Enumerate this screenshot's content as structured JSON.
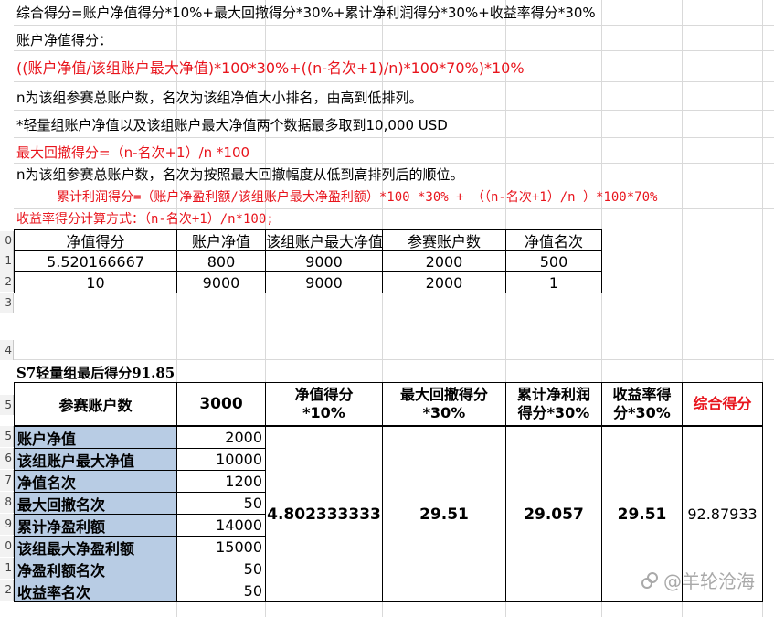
{
  "notes": {
    "l1": "综合得分=账户净值得分*10%+最大回撤得分*30%+累计净利润得分*30%+收益率得分*30%",
    "l2": "账户净值得分：",
    "l3": "((账户净值/该组账户最大净值)*100*30%+((n-名次+1)/n)*100*70%)*10%",
    "l4": "n为该组参赛总账户数，名次为该组净值大小排名，由高到低排列。",
    "l5": "*轻量组账户净值以及该组账户最大净值两个数据最多取到10,000 USD",
    "l6": "最大回撤得分=（n-名次+1）/n *100",
    "l7": "n为该组参赛总账户数，名次为按照最大回撤幅度从低到高排列后的顺位。",
    "l8": "累计利润得分=（账户净盈利额/该组账户最大净盈利额）*100 *30% + （（n-名次+1）/n ）*100*70%",
    "l9": "收益率得分计算方式：（n-名次+1）/n*100;"
  },
  "row_numbers": [
    "0",
    "1",
    "2",
    "3",
    "4",
    "5",
    "6",
    "7",
    "8",
    "9",
    "0",
    "1",
    "2",
    "3"
  ],
  "table1": {
    "headers": [
      "净值得分",
      "账户净值",
      "该组账户最大净值",
      "参赛账户数",
      "净值名次"
    ],
    "rows": [
      [
        "5.520166667",
        "800",
        "9000",
        "2000",
        "500"
      ],
      [
        "10",
        "9000",
        "9000",
        "2000",
        "1"
      ]
    ]
  },
  "table2": {
    "title": "S7轻量组最后得分91.85",
    "header_label": "参赛账户数",
    "header_value": "3000",
    "col_headers": {
      "c1a": "净值得分",
      "c1b": "*10%",
      "c2a": "最大回撤得分",
      "c2b": "*30%",
      "c3a": "累计净利润",
      "c3b": "得分*30%",
      "c4a": "收益率得",
      "c4b": "分*30%",
      "c5": "综合得分"
    },
    "labels": [
      "账户净值",
      "该组账户最大净值",
      "净值名次",
      "最大回撤名次",
      "累计净盈利额",
      "该组最大净盈利额",
      "净盈利额名次",
      "收益率名次"
    ],
    "values": [
      "2000",
      "10000",
      "1200",
      "50",
      "14000",
      "15000",
      "50",
      "50"
    ],
    "scores": [
      "4.802333333",
      "29.51",
      "29.057",
      "29.51",
      "92.87933"
    ]
  },
  "watermark": "@羊轮沧海",
  "colors": {
    "red": "#e8141c",
    "blue_fill": "#b8cce4"
  }
}
